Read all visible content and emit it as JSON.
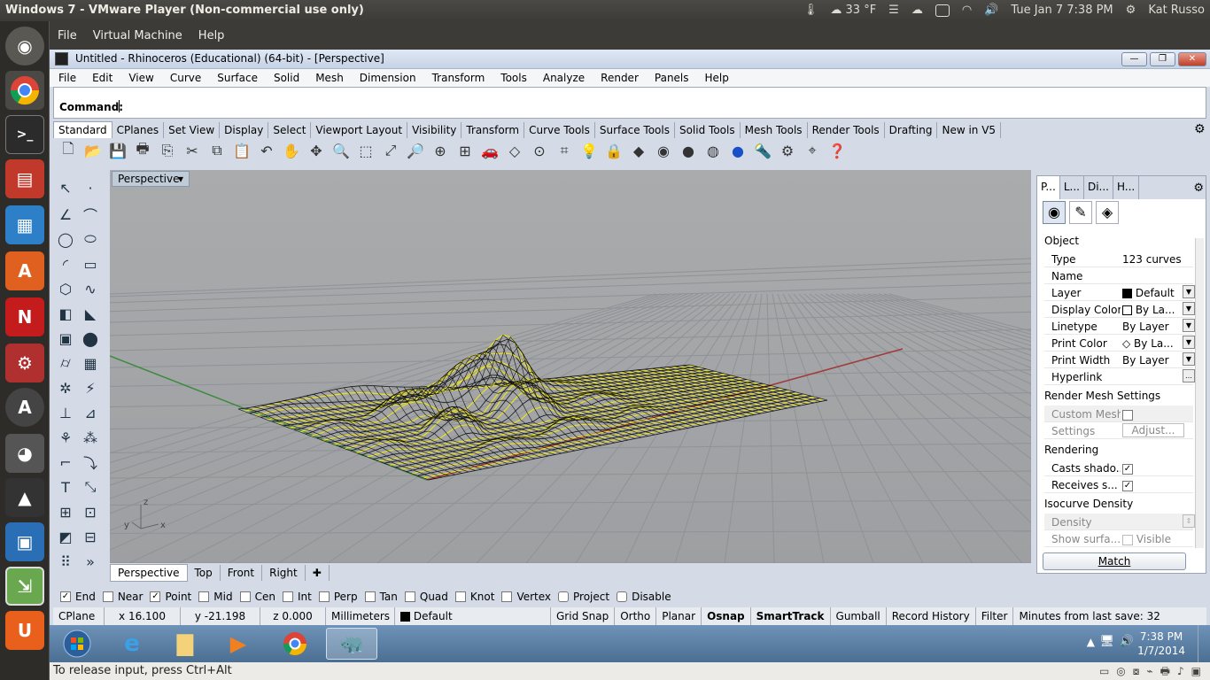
{
  "ubuntu_bar": {
    "title": "Windows 7 - VMware Player (Non-commercial use only)",
    "weather": "33 °F",
    "datetime": "Tue Jan  7   7:38 PM",
    "user": "Kat Russo"
  },
  "vm_menu": [
    "File",
    "Virtual Machine",
    "Help"
  ],
  "rhino": {
    "title": "Untitled - Rhinoceros (Educational) (64-bit) - [Perspective]",
    "menu": [
      "File",
      "Edit",
      "View",
      "Curve",
      "Surface",
      "Solid",
      "Mesh",
      "Dimension",
      "Transform",
      "Tools",
      "Analyze",
      "Render",
      "Panels",
      "Help"
    ],
    "command_label": "Command:",
    "toolbar_tabs": [
      "Standard",
      "CPlanes",
      "Set View",
      "Display",
      "Select",
      "Viewport Layout",
      "Visibility",
      "Transform",
      "Curve Tools",
      "Surface Tools",
      "Solid Tools",
      "Mesh Tools",
      "Render Tools",
      "Drafting",
      "New in V5"
    ],
    "viewport_label": "Perspective",
    "viewport_tabs": [
      "Perspective",
      "Top",
      "Front",
      "Right"
    ],
    "axis_labels": {
      "z": "z",
      "y": "y",
      "x": "x"
    }
  },
  "properties": {
    "tabs": [
      "P...",
      "L...",
      "Di...",
      "H..."
    ],
    "section_object": "Object",
    "rows": [
      {
        "key": "Type",
        "value": "123 curves"
      },
      {
        "key": "Name",
        "value": ""
      },
      {
        "key": "Layer",
        "value": "Default"
      },
      {
        "key": "Display Color",
        "value": "By La..."
      },
      {
        "key": "Linetype",
        "value": "By Layer"
      },
      {
        "key": "Print Color",
        "value": "By La..."
      },
      {
        "key": "Print Width",
        "value": "By Layer"
      },
      {
        "key": "Hyperlink",
        "value": ""
      }
    ],
    "section_render_mesh": "Render Mesh Settings",
    "custom_mesh": "Custom Mesh",
    "settings": "Settings",
    "adjust": "Adjust...",
    "section_rendering": "Rendering",
    "casts_shadows": "Casts shado...",
    "receives_shadows": "Receives s...",
    "section_isocurve": "Isocurve Density",
    "density": "Density",
    "show_surface": "Show surfa...",
    "visible": "Visible",
    "match": "Match"
  },
  "osnaps": [
    {
      "label": "End",
      "checked": true
    },
    {
      "label": "Near",
      "checked": false
    },
    {
      "label": "Point",
      "checked": true
    },
    {
      "label": "Mid",
      "checked": false
    },
    {
      "label": "Cen",
      "checked": false
    },
    {
      "label": "Int",
      "checked": false
    },
    {
      "label": "Perp",
      "checked": false
    },
    {
      "label": "Tan",
      "checked": false
    },
    {
      "label": "Quad",
      "checked": false
    },
    {
      "label": "Knot",
      "checked": false
    },
    {
      "label": "Vertex",
      "checked": false
    },
    {
      "label": "Project",
      "checked": false
    },
    {
      "label": "Disable",
      "checked": false
    }
  ],
  "status": {
    "cplane": "CPlane",
    "x": "x 16.100",
    "y": "y -21.198",
    "z": "z 0.000",
    "units": "Millimeters",
    "layer": "Default",
    "grid_snap": "Grid Snap",
    "ortho": "Ortho",
    "planar": "Planar",
    "osnap": "Osnap",
    "smarttrack": "SmartTrack",
    "gumball": "Gumball",
    "record_history": "Record History",
    "filter": "Filter",
    "minutes": "Minutes from last save: 32"
  },
  "win_clock": {
    "time": "7:38 PM",
    "date": "1/7/2014"
  },
  "vm_status": "To release input, press Ctrl+Alt"
}
